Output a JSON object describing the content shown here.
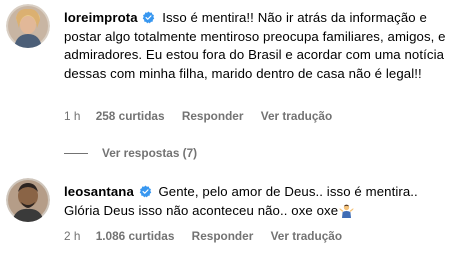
{
  "comments": [
    {
      "username": "loreimprota",
      "verified": true,
      "text": "Isso é mentira!! Não ir atrás da informação e postar algo totalmente mentiroso preocupa familiares, amigos, e admiradores. Eu estou fora do Brasil e acordar com uma notícia dessas com minha filha, marido dentro de casa não é legal!!",
      "time": "1 h",
      "likes": "258 curtidas",
      "reply_label": "Responder",
      "translate_label": "Ver tradução",
      "view_replies": "Ver respostas (7)"
    },
    {
      "username": "leosantana",
      "verified": true,
      "text": "Gente, pelo amor de Deus.. isso é mentira.. Glória Deus isso não aconteceu não.. oxe oxe",
      "emoji": "person-shrugging",
      "time": "2 h",
      "likes": "1.086 curtidas",
      "reply_label": "Responder",
      "translate_label": "Ver tradução"
    }
  ],
  "colors": {
    "verified": "#3897f0",
    "meta": "#737373",
    "text": "#000000"
  }
}
